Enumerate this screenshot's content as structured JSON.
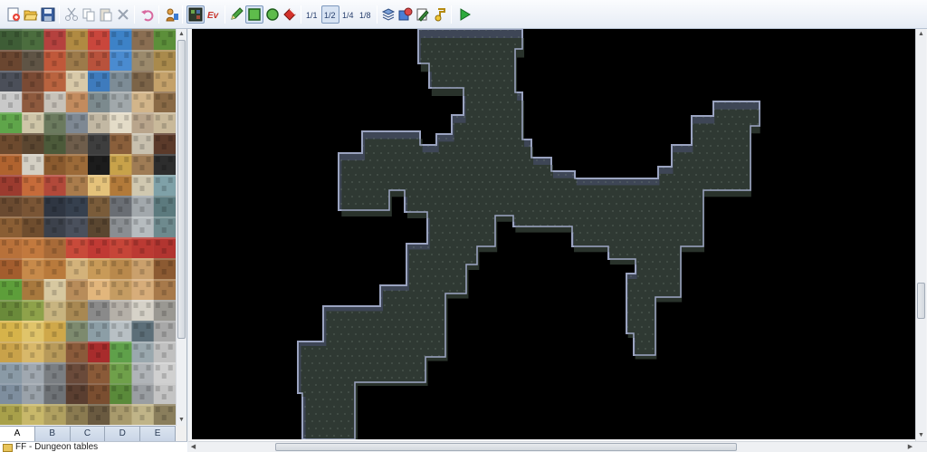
{
  "toolbar": {
    "buttons": [
      {
        "name": "new-project-icon"
      },
      {
        "name": "open-project-icon"
      },
      {
        "name": "save-project-icon"
      },
      {
        "name": "cut-icon"
      },
      {
        "name": "copy-icon"
      },
      {
        "name": "paste-icon"
      },
      {
        "name": "delete-icon"
      },
      {
        "name": "undo-icon"
      },
      {
        "name": "database-icon"
      },
      {
        "name": "map-mode-icon",
        "pressed": true
      },
      {
        "name": "event-mode-icon",
        "label": "Ev"
      },
      {
        "name": "pencil-icon"
      },
      {
        "name": "rectangle-icon",
        "pressed": true
      },
      {
        "name": "ellipse-icon"
      },
      {
        "name": "fill-icon"
      },
      {
        "name": "zoom-1-1-icon",
        "label": "1/1"
      },
      {
        "name": "zoom-1-2-icon",
        "label": "1/2",
        "pressed": true
      },
      {
        "name": "zoom-1-4-icon",
        "label": "1/4"
      },
      {
        "name": "zoom-1-8-icon",
        "label": "1/8"
      },
      {
        "name": "resource-manager-icon"
      },
      {
        "name": "script-editor-icon"
      },
      {
        "name": "sound-test-icon"
      },
      {
        "name": "playtest-icon"
      }
    ]
  },
  "tileset": {
    "tabs": [
      "A",
      "B",
      "C",
      "D",
      "E"
    ],
    "active_tab": "A"
  },
  "map_tree": {
    "root_label": "FF - Dungeon tables"
  },
  "colors": {
    "map_background": "#000000",
    "cave_floor": "#2d3730",
    "cave_wall": "#3e4656",
    "cave_edge": "#9aa3c0"
  }
}
